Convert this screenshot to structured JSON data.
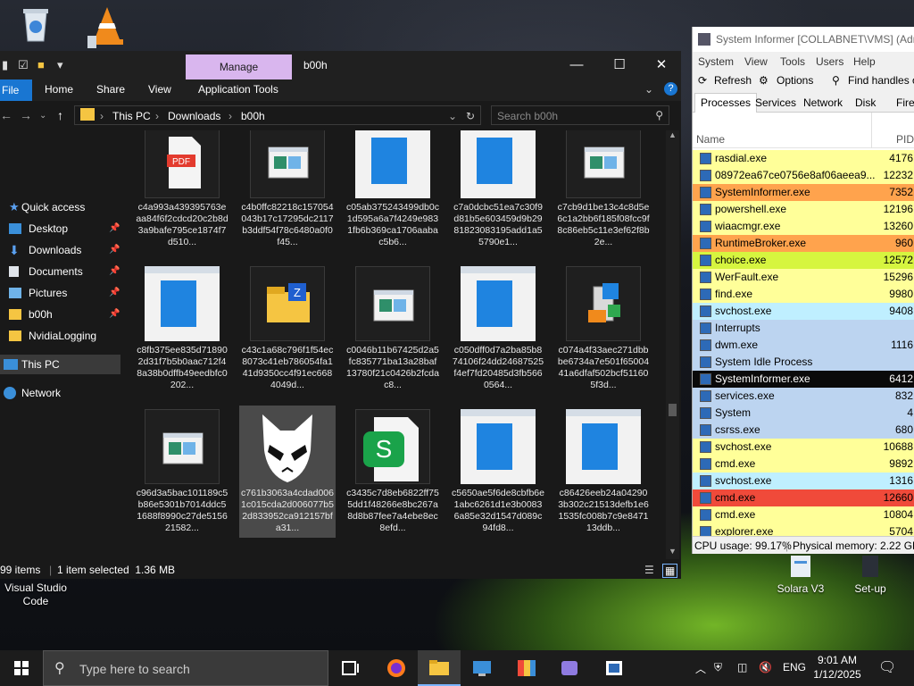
{
  "desktop": {
    "icons": [
      {
        "name": "recycle-bin",
        "label": ""
      },
      {
        "name": "vlc-player",
        "label": ""
      },
      {
        "name": "visual-studio-code",
        "label": "Visual Studio\nCode"
      },
      {
        "name": "solara-v3",
        "label": "Solara V3"
      },
      {
        "name": "set-up",
        "label": "Set-up"
      }
    ]
  },
  "explorer": {
    "manage_tab": "Manage",
    "folder_title": "b00h",
    "ribbon": {
      "file": "File",
      "home": "Home",
      "share": "Share",
      "view": "View",
      "app_tools": "Application Tools"
    },
    "address": {
      "this_pc": "This PC",
      "downloads": "Downloads",
      "folder": "b00h"
    },
    "search_placeholder": "Search b00h",
    "nav": {
      "quick_access": "Quick access",
      "desktop": "Desktop",
      "downloads": "Downloads",
      "documents": "Documents",
      "pictures": "Pictures",
      "b00h": "b00h",
      "nvidia": "NvidiaLogging",
      "this_pc": "This PC",
      "network": "Network"
    },
    "files": [
      {
        "name": "c4a993a439395763eaa84f6f2cdcd20c2b8d3a9bafe795ce1874f7d510...",
        "thumb": "pdf"
      },
      {
        "name": "c4b0ffc82218c157054043b17c17295dc2117b3ddf54f78c6480a0f0f45...",
        "thumb": "small"
      },
      {
        "name": "c05ab375243499db0c1d595a6a7f4249e9831fb6b369ca1706aabac5b6...",
        "thumb": "window"
      },
      {
        "name": "c7a0dcbc51ea7c30f9d81b5e603459d9b2981823083195add1a55790e1...",
        "thumb": "window"
      },
      {
        "name": "c7cb9d1be13c4c8d5e6c1a2bb6f185f08fcc9f8c86eb5c11e3ef62f8b2e...",
        "thumb": "small"
      },
      {
        "name": "c8fb375ee835d718902d31f7b5b0aac712f48a38b0dffb49eedbfc0202...",
        "thumb": "window"
      },
      {
        "name": "c43c1a68c796f1f54ec8073c41eb786054fa141d9350cc4f91ec6684049d...",
        "thumb": "zip"
      },
      {
        "name": "c0046b11b67425d2a5fc835771ba13a28baf13780f21c0426b2fcdac8...",
        "thumb": "small"
      },
      {
        "name": "c050dff0d7a2ba85b874106f24dd24687525f4ef7fd20485d3fb5660564...",
        "thumb": "window"
      },
      {
        "name": "c074a4f33aec271dbbbe6734a7e501f6500441a6dfaf502bcf511605f3d...",
        "thumb": "installer"
      },
      {
        "name": "c96d3a5bac101189c5b86e5301b7014ddc51688f8990c27de515621582...",
        "thumb": "small"
      },
      {
        "name": "c761b3063a4cdad0061c015cda2d006077b52d833952ca912157bfa31...",
        "thumb": "alien"
      },
      {
        "name": "c3435c7d8eb6822ff755dd1f48266e8bc267a8d8b87fee7a4ebe8ec8efd...",
        "thumb": "sheets"
      },
      {
        "name": "c5650ae5f6de8cbfb6e1abc6261d1e3b00836a85e32d1547d089c94fd8...",
        "thumb": "window"
      },
      {
        "name": "c86426eeb24a042903b302c21513defb1e61535fc008b7c9e847113ddb...",
        "thumb": "window"
      }
    ],
    "status": {
      "items": "99 items",
      "selected": "1 item selected  1.36 MB"
    }
  },
  "sysinf": {
    "title": "System Informer [COLLABNET\\VMS] (Adm",
    "menu": {
      "system": "System",
      "view": "View",
      "tools": "Tools",
      "users": "Users",
      "help": "Help"
    },
    "toolbar": {
      "refresh": "Refresh",
      "options": "Options",
      "find": "Find handles o"
    },
    "tabs": {
      "processes": "Processes",
      "services": "Services",
      "network": "Network",
      "disk": "Disk",
      "fire": "Fire"
    },
    "columns": {
      "name": "Name",
      "pid": "PID"
    },
    "processes": [
      {
        "name": "rasdial.exe",
        "pid": "4176",
        "bg": "#ffff99",
        "color": "#000000"
      },
      {
        "name": "08972ea67ce0756e8af06aeea9...",
        "pid": "12232",
        "bg": "#ffff99",
        "color": "#000000"
      },
      {
        "name": "SystemInformer.exe",
        "pid": "7352",
        "bg": "#ffa34d",
        "color": "#000000"
      },
      {
        "name": "powershell.exe",
        "pid": "12196",
        "bg": "#ffff99",
        "color": "#000000"
      },
      {
        "name": "wiaacmgr.exe",
        "pid": "13260",
        "bg": "#ffff99",
        "color": "#000000"
      },
      {
        "name": "RuntimeBroker.exe",
        "pid": "960",
        "bg": "#ffa34d",
        "color": "#000000"
      },
      {
        "name": "choice.exe",
        "pid": "12572",
        "bg": "#d6f53f",
        "color": "#000000"
      },
      {
        "name": "WerFault.exe",
        "pid": "15296",
        "bg": "#ffff99",
        "color": "#000000"
      },
      {
        "name": "find.exe",
        "pid": "9980",
        "bg": "#ffff99",
        "color": "#000000"
      },
      {
        "name": "svchost.exe",
        "pid": "9408",
        "bg": "#bfefff",
        "color": "#000000"
      },
      {
        "name": "Interrupts",
        "pid": "",
        "bg": "#bcd4f0",
        "color": "#000000"
      },
      {
        "name": "dwm.exe",
        "pid": "1116",
        "bg": "#bcd4f0",
        "color": "#000000"
      },
      {
        "name": "System Idle Process",
        "pid": "",
        "bg": "#bcd4f0",
        "color": "#000000"
      },
      {
        "name": "SystemInformer.exe",
        "pid": "6412",
        "bg": "#0a0a0a",
        "color": "#ffffff"
      },
      {
        "name": "services.exe",
        "pid": "832",
        "bg": "#bcd4f0",
        "color": "#000000"
      },
      {
        "name": "System",
        "pid": "4",
        "bg": "#bcd4f0",
        "color": "#000000"
      },
      {
        "name": "csrss.exe",
        "pid": "680",
        "bg": "#bcd4f0",
        "color": "#000000"
      },
      {
        "name": "svchost.exe",
        "pid": "10688",
        "bg": "#ffff99",
        "color": "#000000"
      },
      {
        "name": "cmd.exe",
        "pid": "9892",
        "bg": "#ffff99",
        "color": "#000000"
      },
      {
        "name": "svchost.exe",
        "pid": "1316",
        "bg": "#bfefff",
        "color": "#000000"
      },
      {
        "name": "cmd.exe",
        "pid": "12660",
        "bg": "#f04a3a",
        "color": "#000000"
      },
      {
        "name": "cmd.exe",
        "pid": "10804",
        "bg": "#ffff99",
        "color": "#000000"
      },
      {
        "name": "explorer.exe",
        "pid": "5704",
        "bg": "#ffff99",
        "color": "#000000"
      }
    ],
    "status": {
      "cpu": "CPU usage: 99.17%",
      "mem": "Physical memory: 2.22 GB"
    }
  },
  "taskbar": {
    "search_placeholder": "Type here to search",
    "lang": "ENG",
    "time": "9:01 AM",
    "date": "1/12/2025"
  },
  "colors": {
    "explorer_bg": "#191919",
    "manage_tab": "#d9b6ee",
    "file_button": "#1976d2",
    "selection": "#4a4a4a",
    "taskbar": "#1c1c1c"
  }
}
